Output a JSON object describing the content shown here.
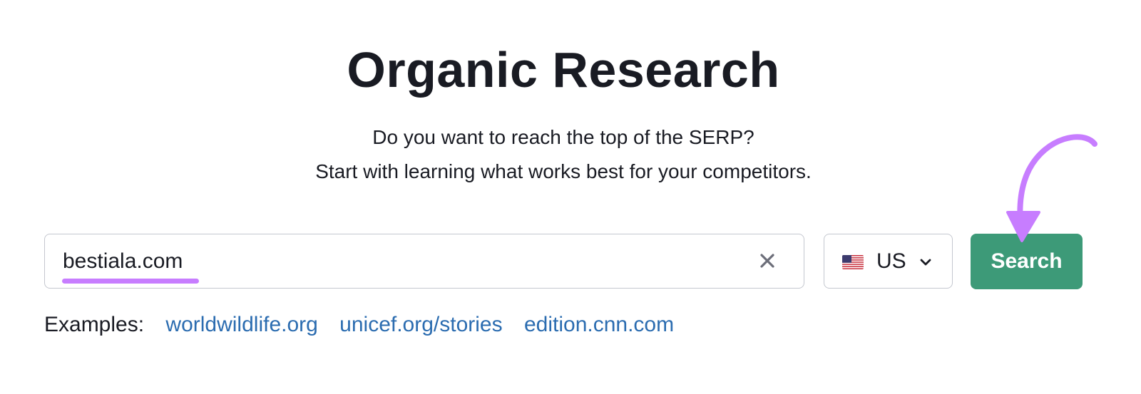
{
  "header": {
    "title": "Organic Research",
    "subtitle_line1": "Do you want to reach the top of the SERP?",
    "subtitle_line2": "Start with learning what works best for your competitors."
  },
  "search": {
    "value": "bestiala.com",
    "clear_icon": "close-icon",
    "button_label": "Search"
  },
  "country": {
    "flag_icon": "us-flag-icon",
    "label": "US",
    "chevron_icon": "chevron-down-icon"
  },
  "examples": {
    "label": "Examples:",
    "links": [
      "worldwildlife.org",
      "unicef.org/stories",
      "edition.cnn.com"
    ]
  },
  "colors": {
    "search_button": "#3d9a78",
    "link": "#2b6cb0",
    "annotation": "#c77dff",
    "text": "#191b23"
  }
}
